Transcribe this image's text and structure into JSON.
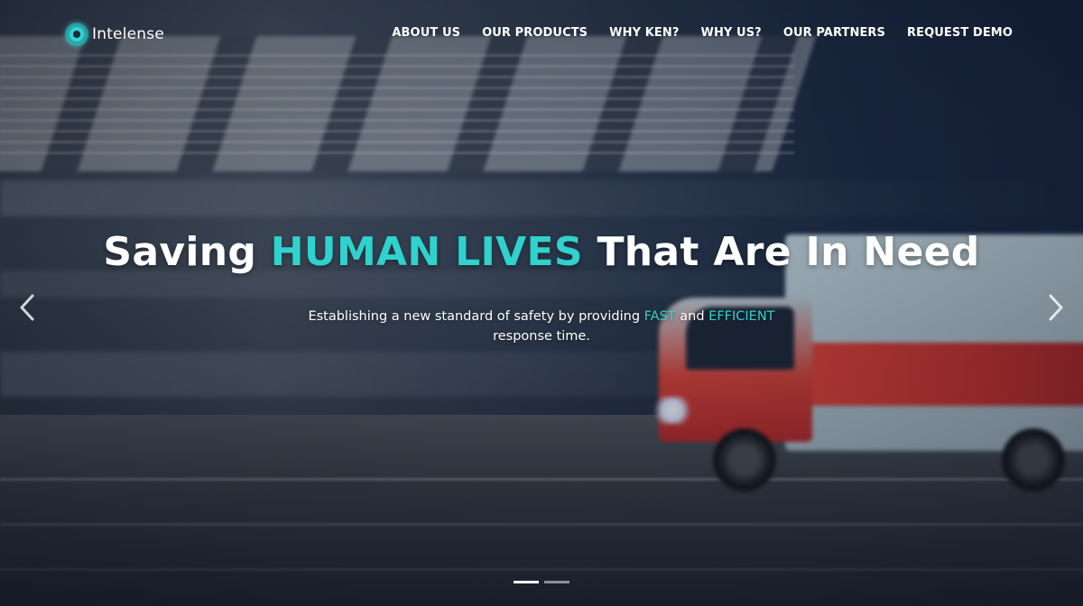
{
  "brand": {
    "name": "Intelense",
    "accent_color": "#2fd2cc"
  },
  "nav": {
    "items": [
      {
        "label": "ABOUT US"
      },
      {
        "label": "OUR PRODUCTS"
      },
      {
        "label": "WHY KEN?"
      },
      {
        "label": "WHY US?"
      },
      {
        "label": "OUR PARTNERS"
      },
      {
        "label": "REQUEST DEMO"
      }
    ]
  },
  "hero": {
    "headline_part1": "Saving ",
    "headline_accent": "HUMAN LIVES",
    "headline_part2": " That Are In Need",
    "sub_part1": "Establishing a new standard of safety by providing ",
    "sub_accent1": "FAST",
    "sub_part2": " and ",
    "sub_accent2": "EFFICIENT",
    "sub_line2": "response time.",
    "prev_icon": "chevron-left-icon",
    "next_icon": "chevron-right-icon"
  },
  "carousel": {
    "slide_count": 2,
    "active_index": 0
  }
}
